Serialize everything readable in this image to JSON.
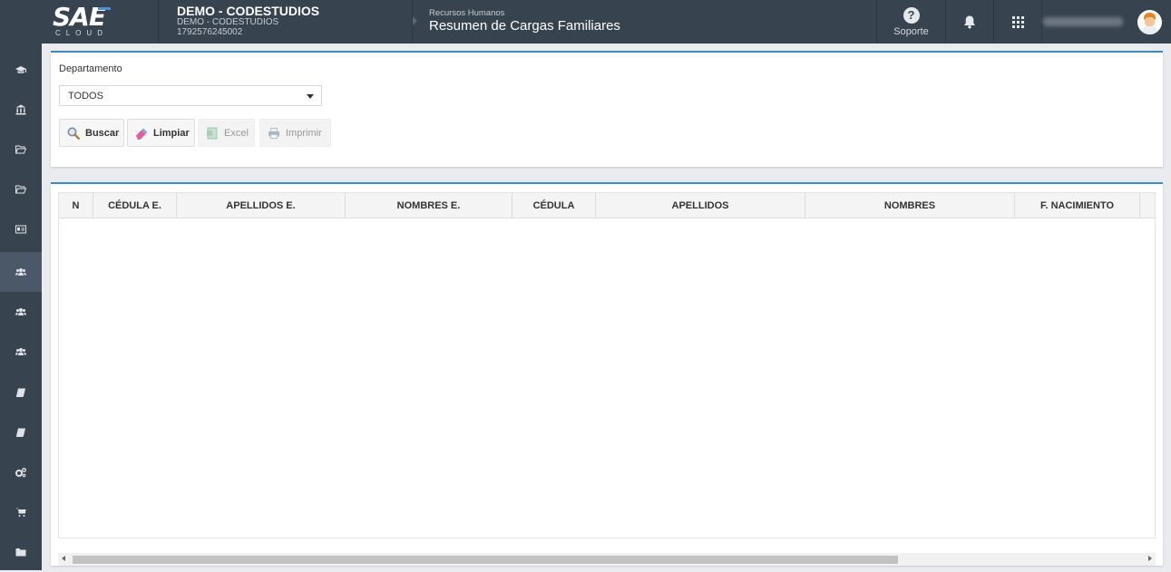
{
  "header": {
    "logo_text": "SAE",
    "logo_sub": "CLOUD",
    "company_name": "DEMO - CODESTUDIOS",
    "company_sub": "DEMO - CODESTUDIOS",
    "company_ruc": "1792576245002",
    "module": "Recursos Humanos",
    "page_title": "Resumen de Cargas Familiares",
    "support_label": "Soporte"
  },
  "sidebar": {
    "items": [
      {
        "icon": "graduation-cap-icon"
      },
      {
        "icon": "bank-icon"
      },
      {
        "icon": "folder-open-icon"
      },
      {
        "icon": "folder-open-icon"
      },
      {
        "icon": "id-card-icon"
      },
      {
        "icon": "users-icon",
        "active": true
      },
      {
        "icon": "users-icon"
      },
      {
        "icon": "users-icon"
      },
      {
        "icon": "book-icon"
      },
      {
        "icon": "book-icon"
      },
      {
        "icon": "cogs-icon"
      },
      {
        "icon": "cart-icon"
      },
      {
        "icon": "folder-icon"
      }
    ]
  },
  "filter": {
    "department_label": "Departamento",
    "department_value": "TODOS",
    "buttons": {
      "search": "Buscar",
      "clear": "Limpiar",
      "excel": "Excel",
      "print": "Imprimir"
    }
  },
  "table": {
    "columns": [
      "N",
      "CÉDULA E.",
      "APELLIDOS E.",
      "NOMBRES E.",
      "CÉDULA",
      "APELLIDOS",
      "NOMBRES",
      "F. NACIMIENTO"
    ],
    "rows": []
  },
  "colors": {
    "topbar": "#37434f",
    "accent": "#3c8dbc",
    "sidebar_active": "#4a5867"
  }
}
